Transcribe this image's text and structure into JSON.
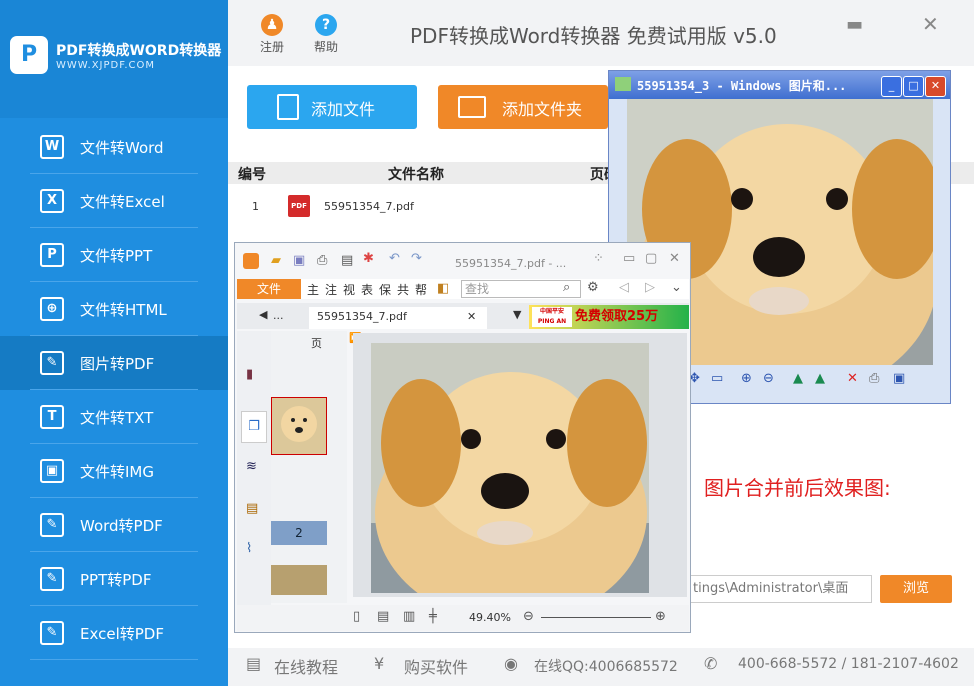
{
  "sidebar": {
    "brand_title": "PDF转换成WORD转换器",
    "brand_url": "WWW.XJPDF.COM",
    "items": [
      {
        "label": "文件转Word",
        "icon": "W"
      },
      {
        "label": "文件转Excel",
        "icon": "X"
      },
      {
        "label": "文件转PPT",
        "icon": "P"
      },
      {
        "label": "文件转HTML",
        "icon": "⊕"
      },
      {
        "label": "图片转PDF",
        "icon": "✎"
      },
      {
        "label": "文件转TXT",
        "icon": "T"
      },
      {
        "label": "文件转IMG",
        "icon": "▣"
      },
      {
        "label": "Word转PDF",
        "icon": "✎"
      },
      {
        "label": "PPT转PDF",
        "icon": "✎"
      },
      {
        "label": "Excel转PDF",
        "icon": "✎"
      }
    ],
    "active_index": 4
  },
  "header": {
    "register_label": "注册",
    "help_label": "帮助",
    "title": "PDF转换成Word转换器 免费试用版 v5.0"
  },
  "actions": {
    "add_file": "添加文件",
    "add_folder": "添加文件夹"
  },
  "table": {
    "col_no": "编号",
    "col_name": "文件名称",
    "col_pages": "页码",
    "row1": {
      "no": "1",
      "name": "55951354_7.pdf"
    }
  },
  "viewer": {
    "title": "55951354_3 - Windows 图片和..."
  },
  "reader": {
    "title": "55951354_7.pdf - ...",
    "file_menu": "文件",
    "menu": [
      "主",
      "注",
      "视",
      "表",
      "保",
      "共",
      "帮"
    ],
    "search_placeholder": "查找",
    "tab_dots": "...",
    "tab_name": "55951354_7.pdf",
    "ad_text": "免费领取25万",
    "ad_brand": "中国平安 PING AN",
    "page_header": "页",
    "thumb2_label": "2",
    "zoom": "49.40%"
  },
  "panel": {
    "note": "图片合并前后效果图:",
    "path_value": "tings\\Administrator\\桌面",
    "browse_label": "浏览"
  },
  "footer": {
    "tutorial": "在线教程",
    "buy": "购买软件",
    "qq": "在线QQ:4006685572",
    "phone": "400-668-5572 / 181-2107-4602"
  },
  "colors": {
    "sidebar_bg": "#1f8ee0",
    "accent_orange": "#f08828",
    "accent_blue": "#2ba6ef",
    "note_red": "#e02020"
  }
}
